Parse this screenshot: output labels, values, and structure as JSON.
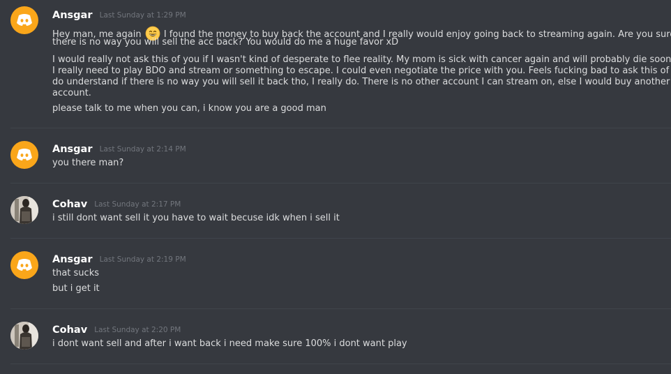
{
  "messages": [
    {
      "author": "Ansgar",
      "time": "Last Sunday at 1:29 PM",
      "avatar": "discord-default-orange",
      "lines": [
        {
          "before_emoji": "Hey man, me again",
          "emoji": "grinning-face-emoji",
          "after_emoji": "I found the money to buy back the account and I really would enjoy going back to streaming again. Are you sure"
        },
        "there is no way you will sell the acc back? You would do me a huge favor xD",
        "I would really not ask this of you if I wasn't kind of desperate to flee reality. My mom is sick with cancer again and will probably die soon.",
        "I really need to play BDO and stream or something to escape. I could even negotiate the price with you. Feels fucking bad to ask this of you, I",
        "do understand if there is no way you will sell it back tho, I really do. There is no other account I can stream on, else I would buy another",
        "account.",
        "please talk to me when you can, i know you are a good man"
      ]
    },
    {
      "author": "Ansgar",
      "time": "Last Sunday at 2:14 PM",
      "avatar": "discord-default-orange",
      "lines": [
        "you there man?"
      ]
    },
    {
      "author": "Cohav",
      "time": "Last Sunday at 2:17 PM",
      "avatar": "user-photo",
      "lines": [
        "i still dont want sell it you have to wait becuse idk when i sell it"
      ]
    },
    {
      "author": "Ansgar",
      "time": "Last Sunday at 2:19 PM",
      "avatar": "discord-default-orange",
      "lines": [
        "that sucks",
        "but i get it"
      ]
    },
    {
      "author": "Cohav",
      "time": "Last Sunday at 2:20 PM",
      "avatar": "user-photo",
      "lines": [
        "i dont want sell and after i want back i need make sure 100% i dont want play"
      ]
    }
  ],
  "colors": {
    "background": "#36393f",
    "username": "#ffffff",
    "timestamp": "#72767d",
    "text": "#dcddde",
    "discord_avatar": "#faa61a"
  }
}
